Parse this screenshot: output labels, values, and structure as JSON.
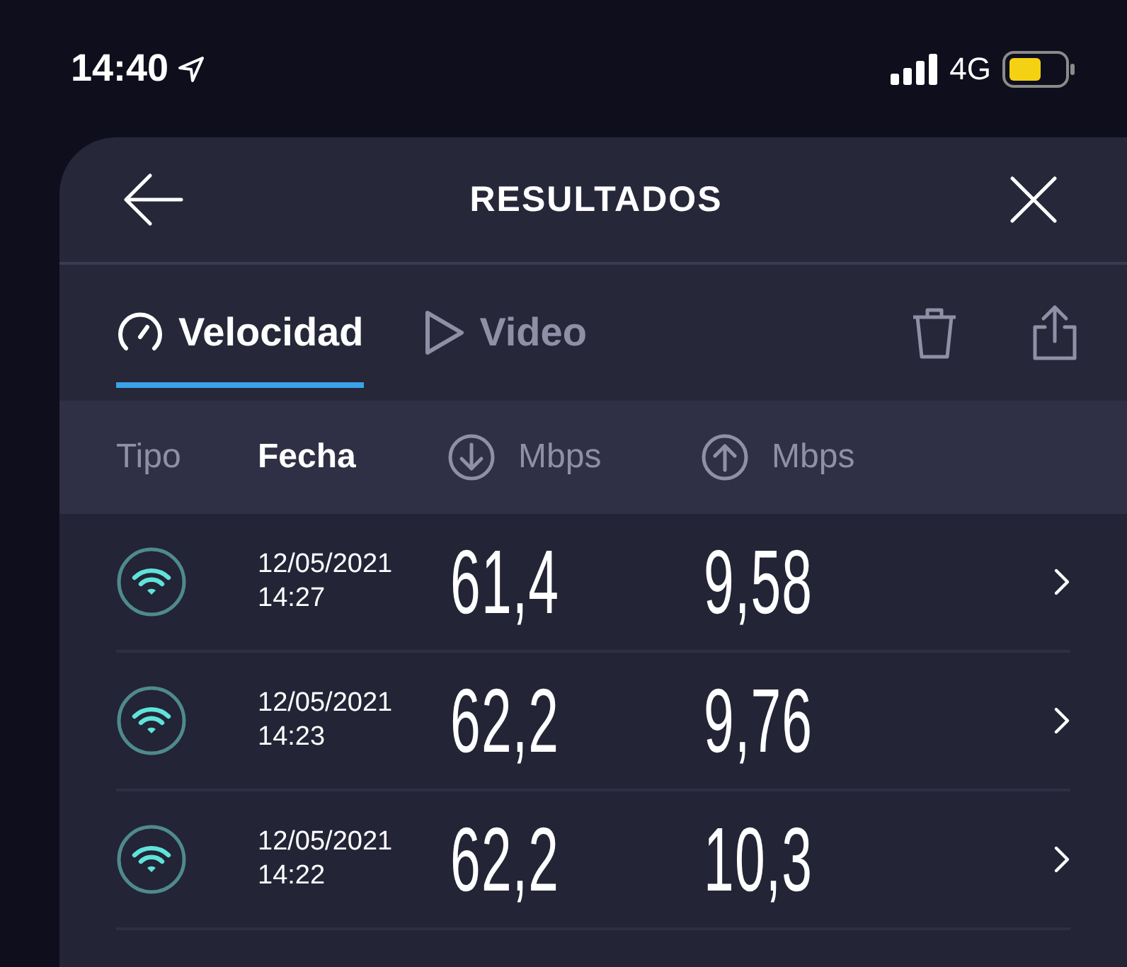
{
  "status_bar": {
    "time": "14:40",
    "network": "4G"
  },
  "header": {
    "title": "RESULTADOS"
  },
  "tabs": [
    {
      "label": "Velocidad",
      "kind": "gauge",
      "selected": true
    },
    {
      "label": "Video",
      "kind": "play",
      "selected": false
    }
  ],
  "columns": [
    {
      "label": "Tipo",
      "kind": "text",
      "selected": false
    },
    {
      "label": "Fecha",
      "kind": "text",
      "selected": true
    },
    {
      "label": "Mbps",
      "kind": "download",
      "selected": false
    },
    {
      "label": "Mbps",
      "kind": "upload",
      "selected": false
    }
  ],
  "rows": [
    {
      "kind": "wifi",
      "date": "12/05/2021",
      "time": "14:27",
      "download": "61,4",
      "upload": "9,58"
    },
    {
      "kind": "wifi",
      "date": "12/05/2021",
      "time": "14:23",
      "download": "62,2",
      "upload": "9,76"
    },
    {
      "kind": "wifi",
      "date": "12/05/2021",
      "time": "14:22",
      "download": "62,2",
      "upload": "10,3"
    }
  ]
}
